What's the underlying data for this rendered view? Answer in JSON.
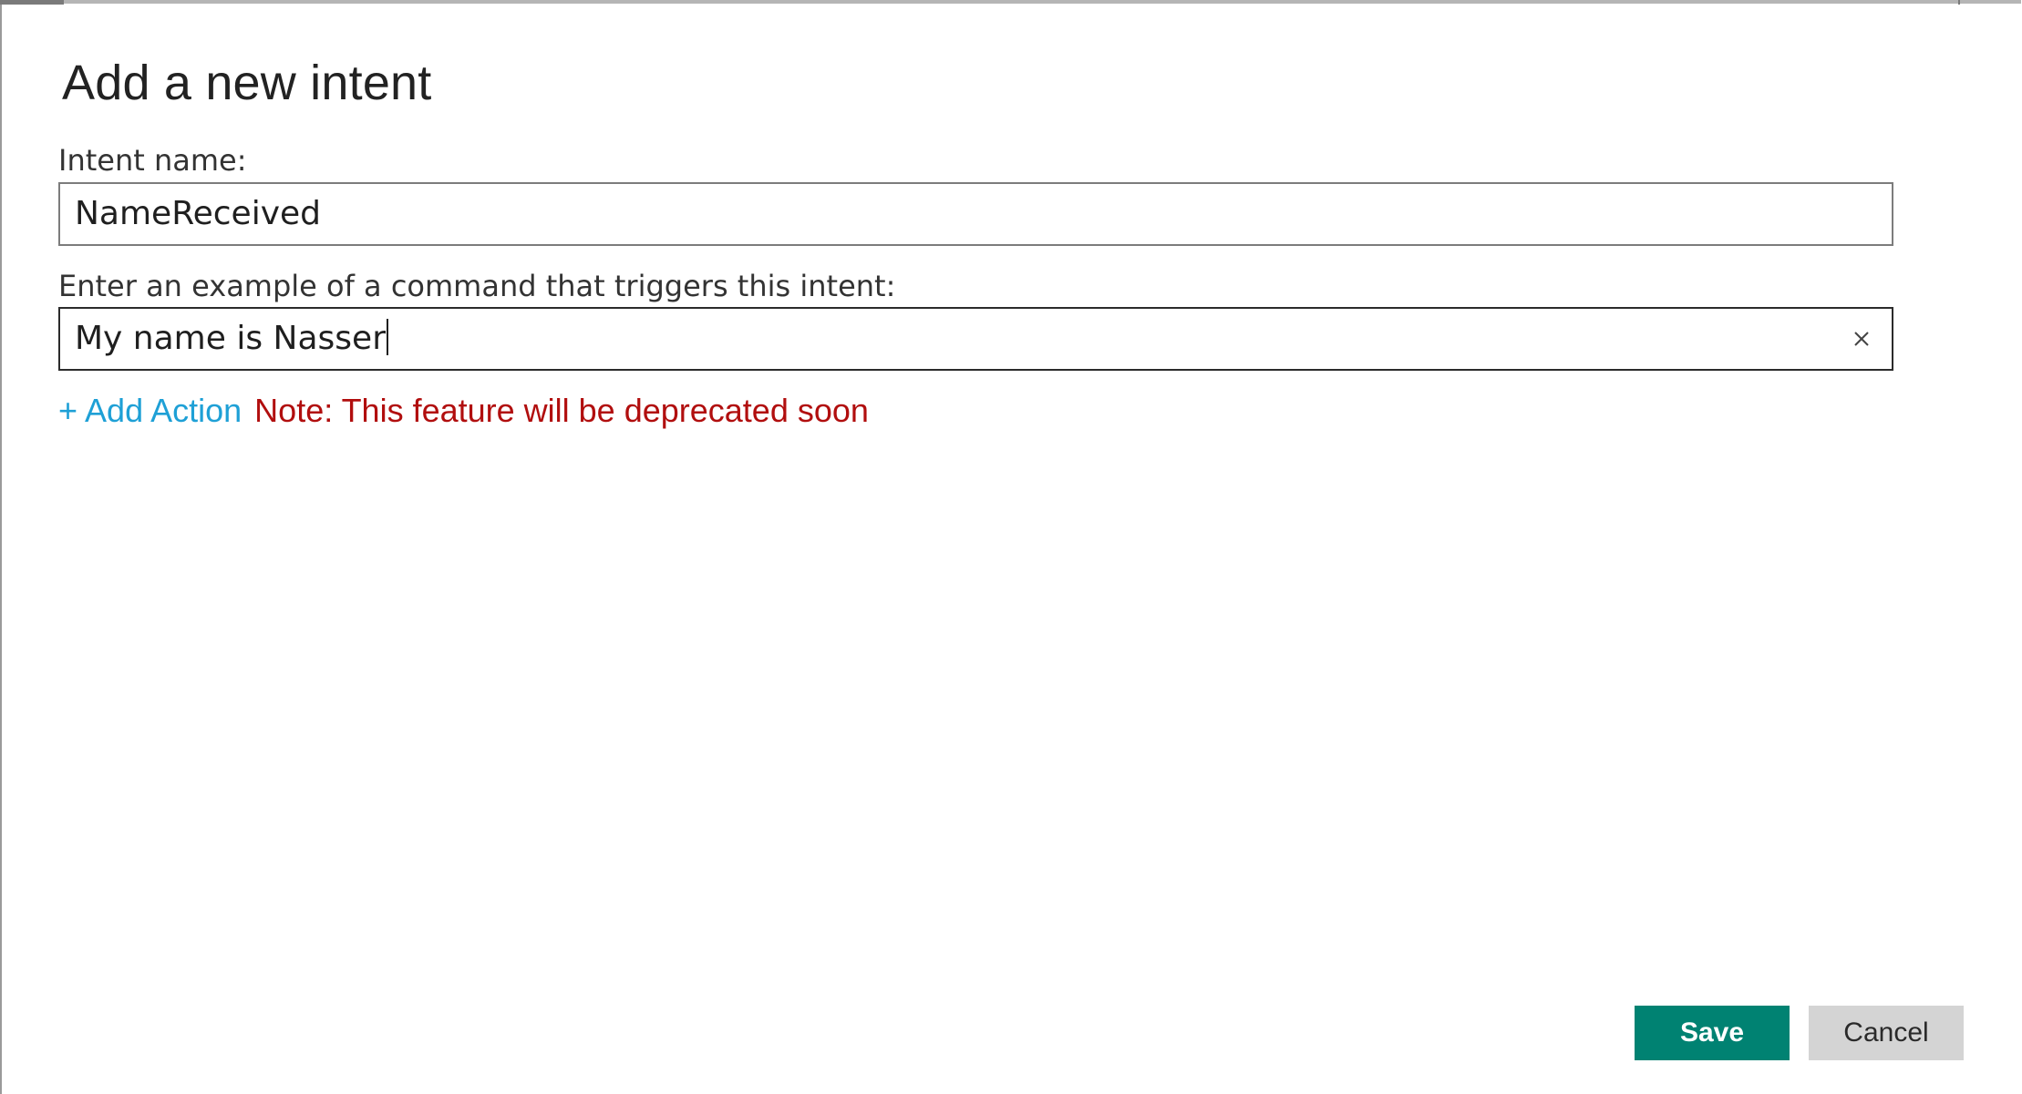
{
  "dialog": {
    "title": "Add a new intent"
  },
  "intent_name": {
    "label": "Intent name:",
    "value": "NameReceived"
  },
  "example_command": {
    "label": "Enter an example of a command that triggers this intent:",
    "value": "My name is Nasser",
    "clear_icon": "close-icon"
  },
  "actions": {
    "add_action_label": "+ Add Action",
    "note": "Note: This feature will be deprecated soon"
  },
  "buttons": {
    "save_label": "Save",
    "cancel_label": "Cancel"
  },
  "colors": {
    "save_button": "#008272",
    "cancel_button": "#d4d4d4",
    "link": "#1ea0d6",
    "warning": "#b10e0e"
  }
}
